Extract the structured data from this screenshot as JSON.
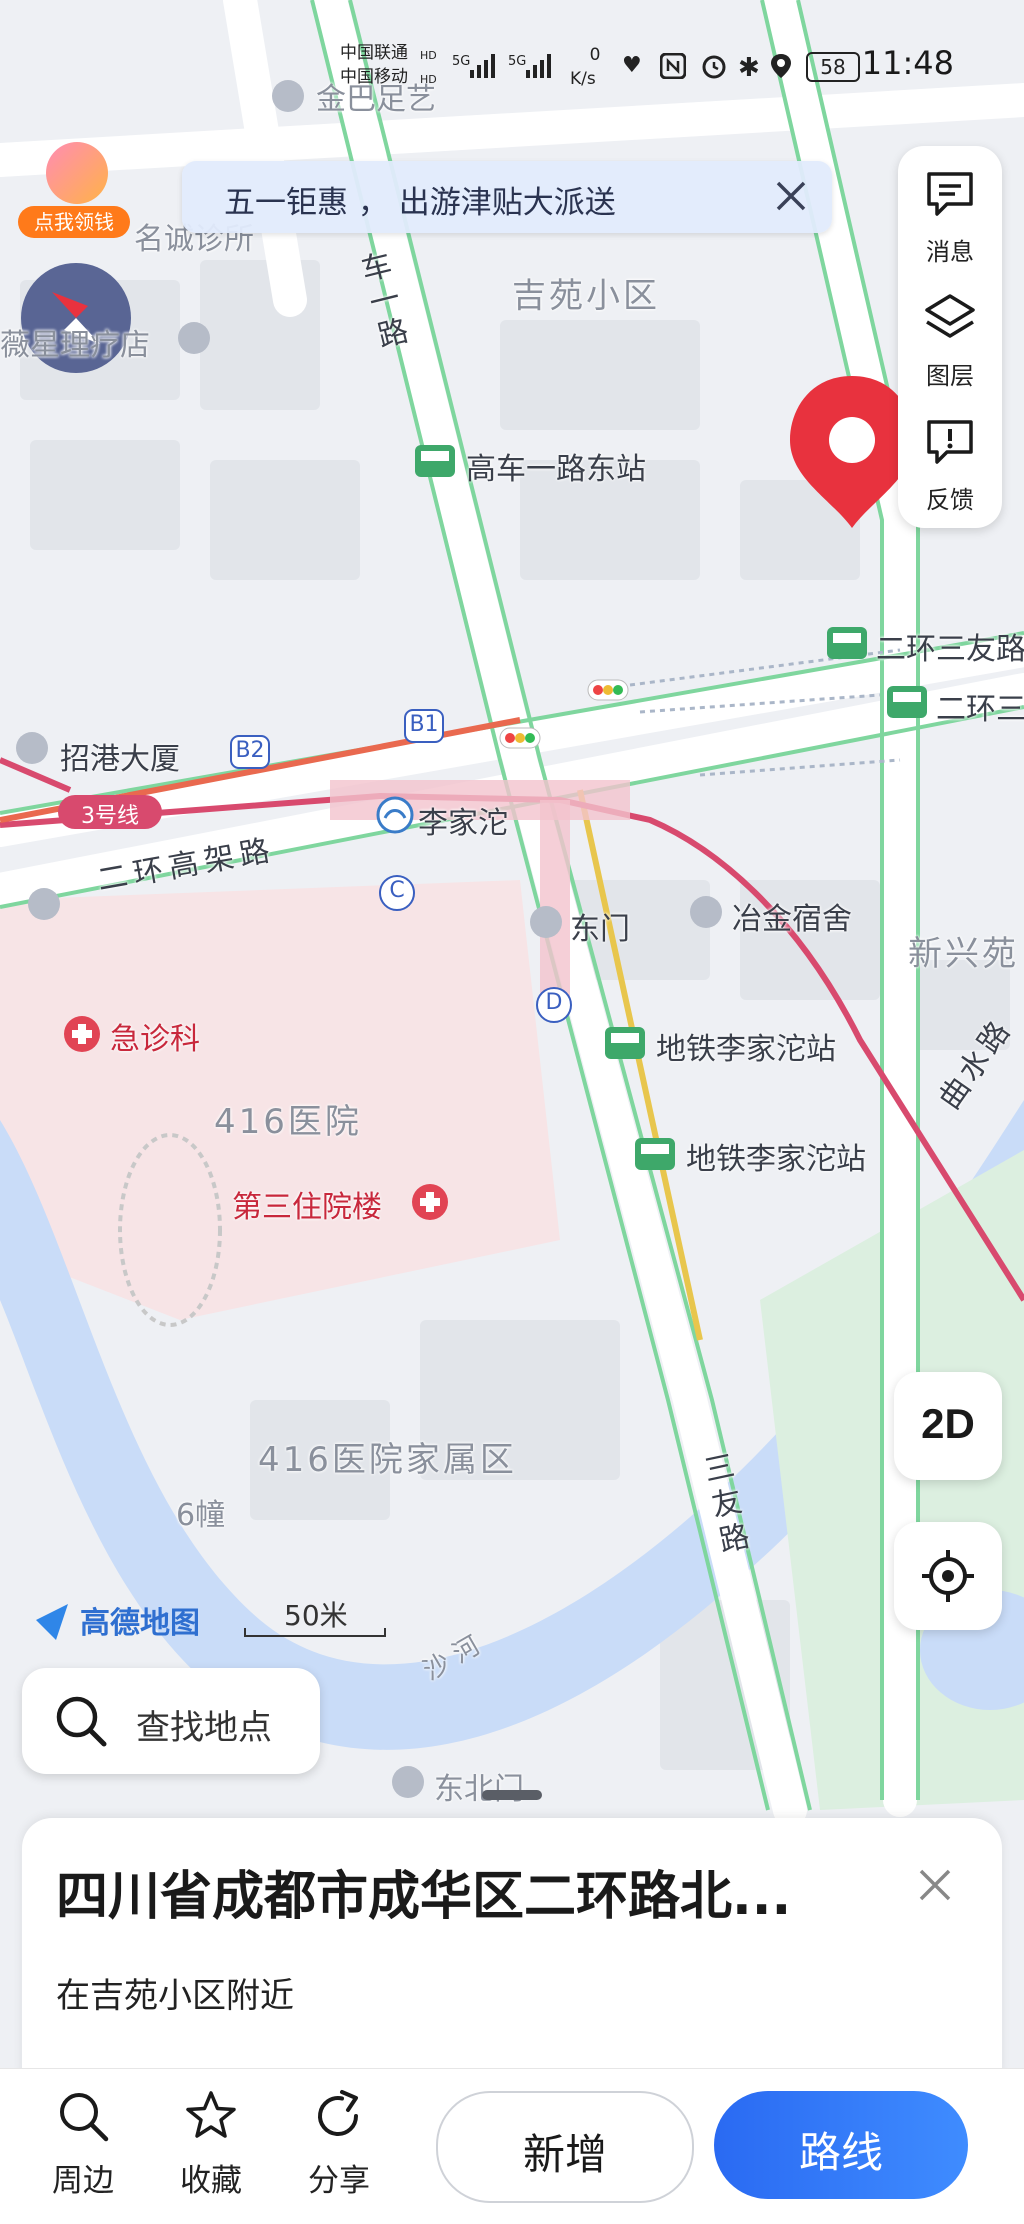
{
  "status_bar": {
    "carrier_1": "中国联通",
    "carrier_2": "中国移动",
    "hd_1": "HD",
    "hd_2": "HD",
    "net_1": "5G",
    "net_2": "5G",
    "speed_value": "0",
    "speed_unit": "K/s",
    "battery": "58",
    "time": "11:48"
  },
  "promo": {
    "badge_text": "点我领钱",
    "banner_text": "五一钜惠 ， 出游津贴大派送"
  },
  "toolbar": {
    "messages_label": "消息",
    "layers_label": "图层",
    "feedback_label": "反馈"
  },
  "map": {
    "labels": {
      "jinba": "金巴足艺",
      "mingcheng": "名诚诊所",
      "weixing": "薇星理疗店",
      "jiyuan": "吉苑小区",
      "gaoche_road": "车一路",
      "gaoche_station": "高车一路东站",
      "erhuan_sanyou_1": "二环三友路",
      "erhuan_sanyou_2": "二环三",
      "zhaogang": "招港大厦",
      "b1": "B1",
      "b2": "B2",
      "line3": "3号线",
      "lijiatuo": "李家沱",
      "erhuan_gaojia": "二环高架路",
      "exit_c": "C",
      "dongmen": "东门",
      "yejin": "冶金宿舍",
      "xinxing": "新兴苑",
      "exit_d": "D",
      "metro_station_1": "地铁李家沱站",
      "metro_station_2": "地铁李家沱站",
      "quzhui": "曲水路",
      "emergency": "急诊科",
      "hospital": "416医院",
      "inpatient": "第三住院楼",
      "family_area": "416医院家属区",
      "building6": "6幢",
      "sanyou_road": "三友路",
      "sha_river": "沙河",
      "dongbeimen": "东北门"
    },
    "brand": "高德地图",
    "scale": "50米"
  },
  "controls": {
    "mode_2d": "2D"
  },
  "search": {
    "placeholder": "查找地点"
  },
  "card": {
    "title": "四川省成都市成华区二环路北...",
    "subtitle": "在吉苑小区附近"
  },
  "bottom_bar": {
    "nearby": "周边",
    "favorite": "收藏",
    "share": "分享",
    "add": "新增",
    "route": "路线"
  },
  "colors": {
    "route_blue": "#3a7cf7",
    "marker_red": "#e8323e",
    "metro_pink": "#d84a6e",
    "road_green": "#7fd69e"
  }
}
